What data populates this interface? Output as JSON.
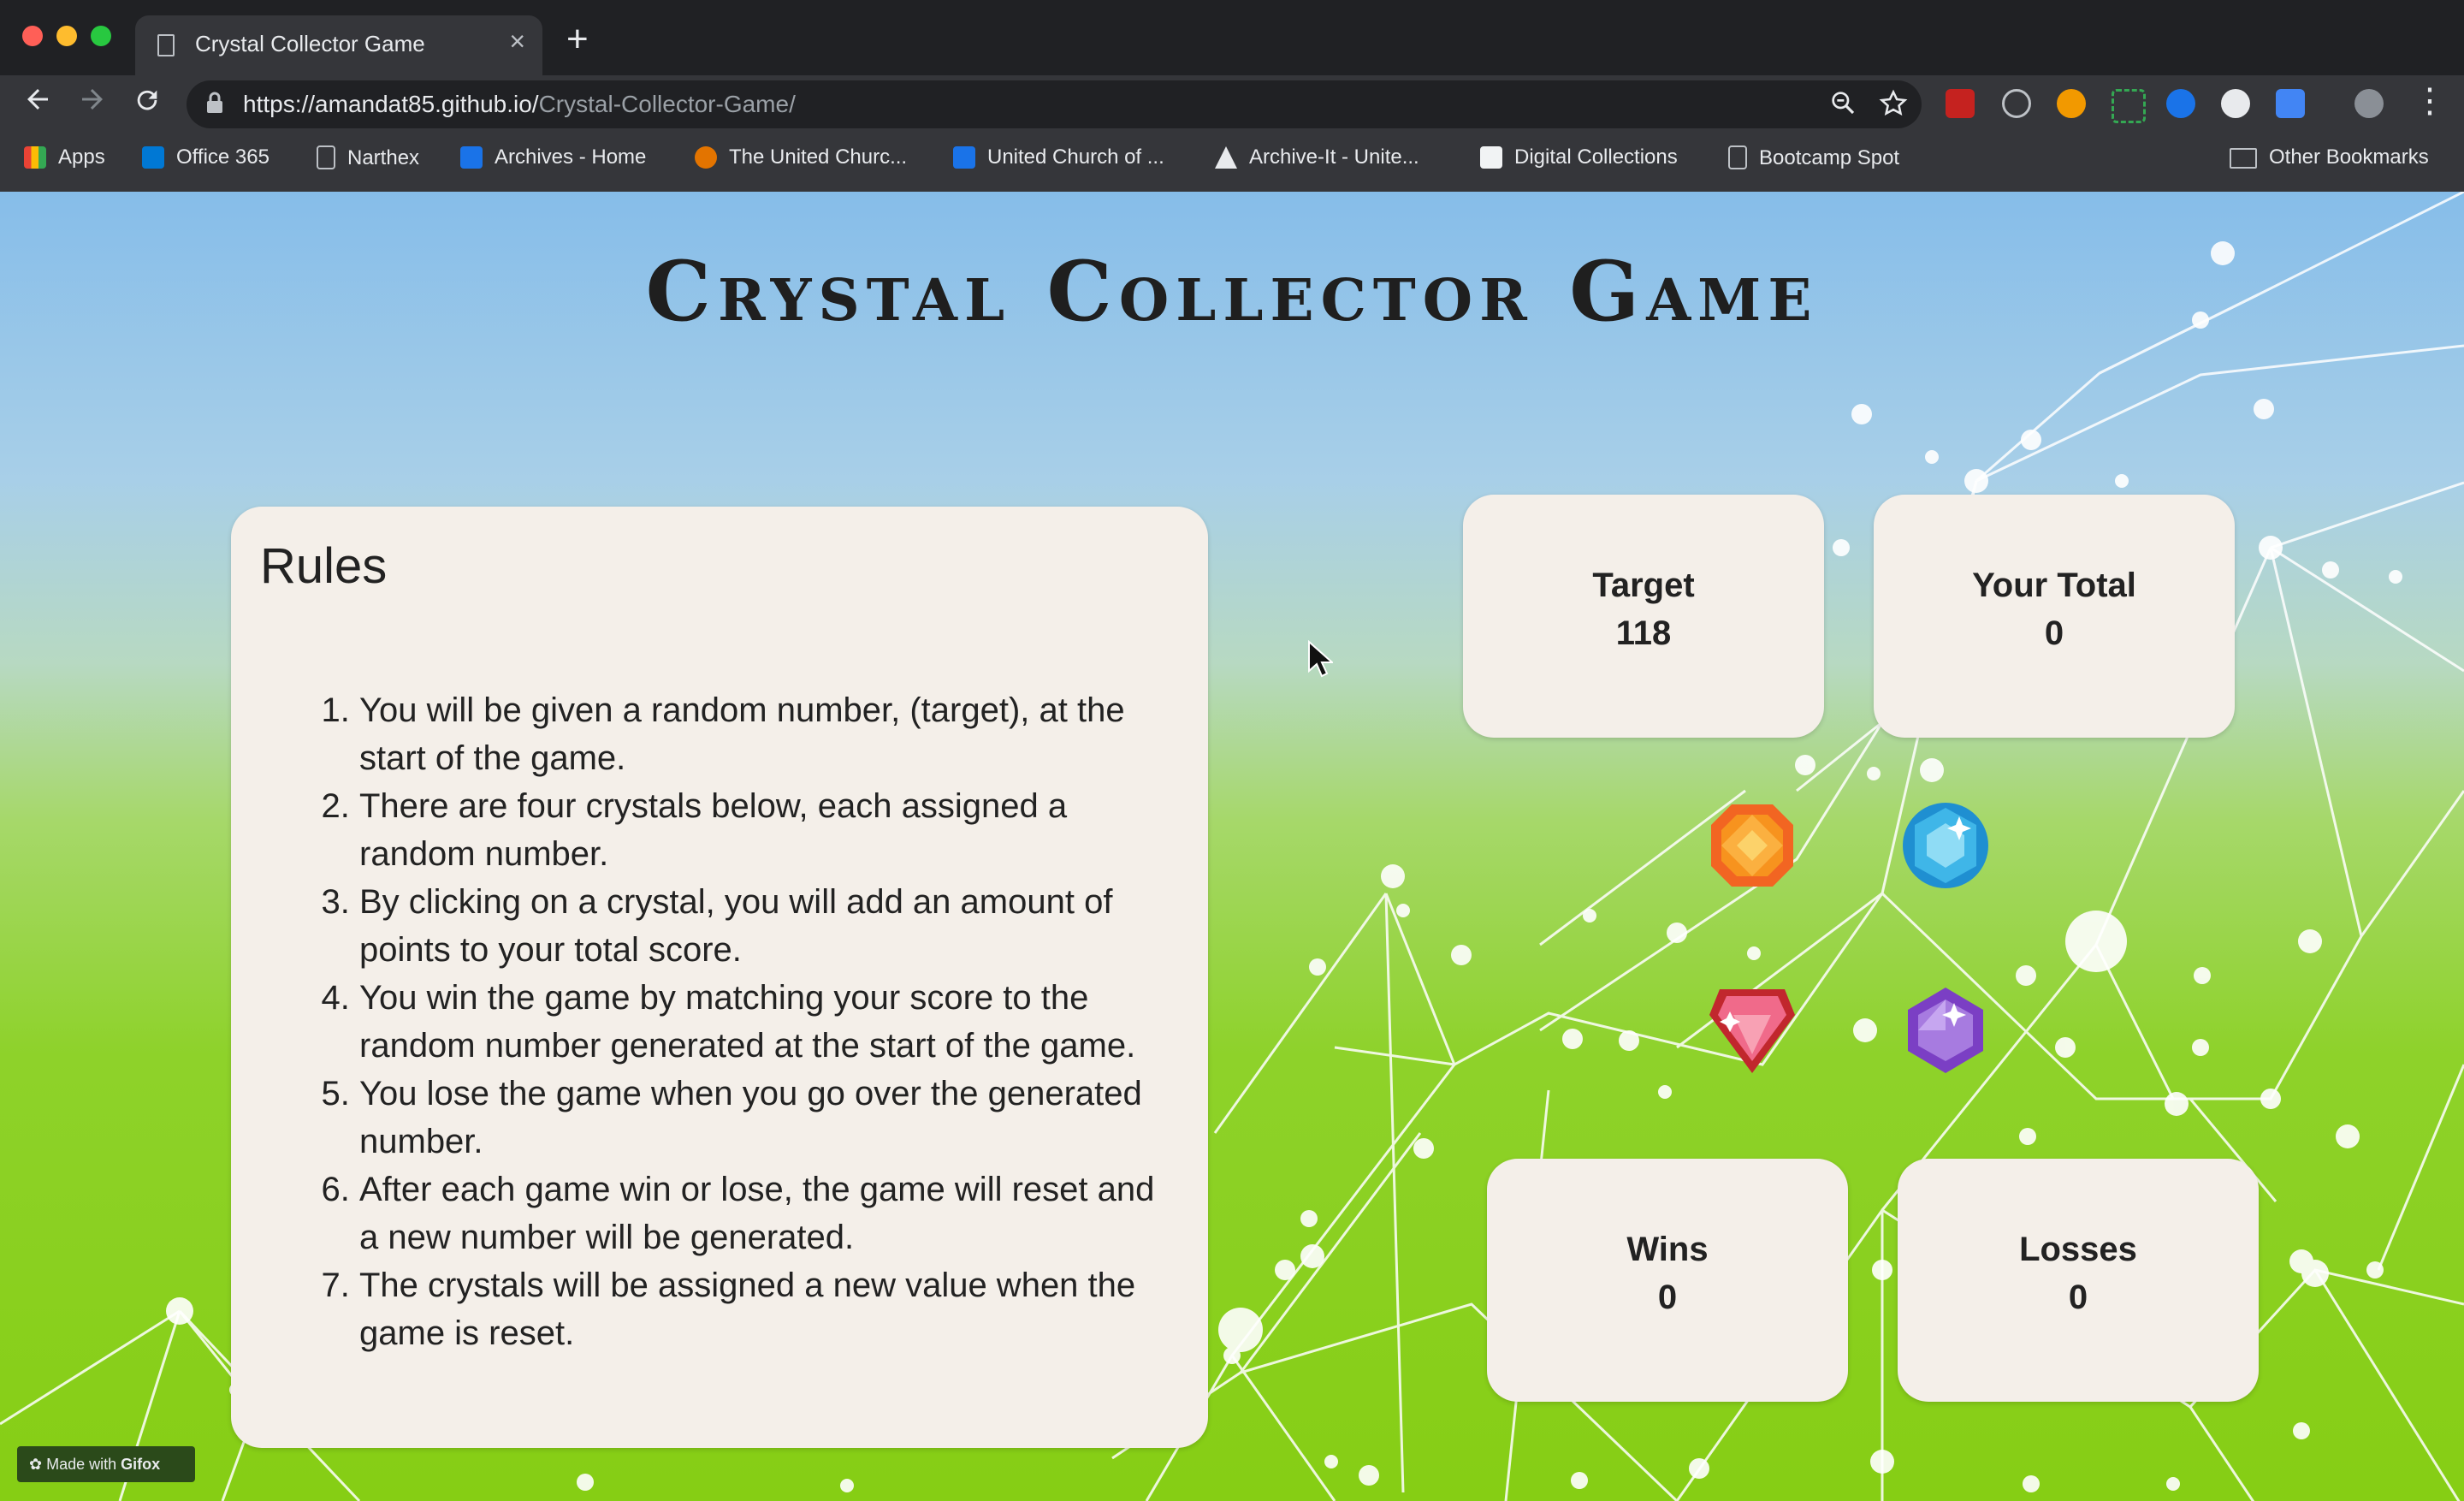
{
  "browser": {
    "tab_title": "Crystal Collector Game",
    "tab_close": "×",
    "new_tab": "+",
    "url_host": "https://amandat85.github.io/",
    "url_path": "Crystal-Collector-Game/",
    "bookmarks": [
      {
        "label": "Apps",
        "color": "#ea4335"
      },
      {
        "label": "Office 365",
        "color": "#0078d4"
      },
      {
        "label": "Narthex",
        "color": "#bdc1c6"
      },
      {
        "label": "Archives - Home",
        "color": "#1a73e8"
      },
      {
        "label": "The United Churc...",
        "color": "#e37400"
      },
      {
        "label": "United Church of ...",
        "color": "#1a73e8"
      },
      {
        "label": "Archive-It - Unite...",
        "color": "#000000"
      },
      {
        "label": "Digital Collections",
        "color": "#c5221f"
      },
      {
        "label": "Bootcamp Spot",
        "color": "#bdc1c6"
      }
    ],
    "other_bookmarks": "Other Bookmarks"
  },
  "game": {
    "title": "Crystal Collector Game",
    "rules_heading": "Rules",
    "rules": [
      "You will be given a random number, (target), at the start of the game.",
      "There are four crystals below, each assigned a random number.",
      "By clicking on a crystal, you will add an amount of points to your total score.",
      "You win the game by matching your score to the random number generated at the start of the game.",
      "You lose the game when you go over the generated number.",
      "After each game win or lose, the game will reset and a new number will be generated.",
      "The crystals will be assigned a new value when the game is reset."
    ],
    "target_label": "Target",
    "target_value": "118",
    "total_label": "Your Total",
    "total_value": "0",
    "wins_label": "Wins",
    "wins_value": "0",
    "losses_label": "Losses",
    "losses_value": "0",
    "crystals": [
      {
        "name": "orange-crystal",
        "color": "#f7931e"
      },
      {
        "name": "blue-crystal",
        "color": "#3fb6e8"
      },
      {
        "name": "red-crystal",
        "color": "#e8283a"
      },
      {
        "name": "purple-crystal",
        "color": "#9b5fd6"
      }
    ]
  },
  "watermark": {
    "prefix": "Made with ",
    "brand": "Gifox"
  }
}
